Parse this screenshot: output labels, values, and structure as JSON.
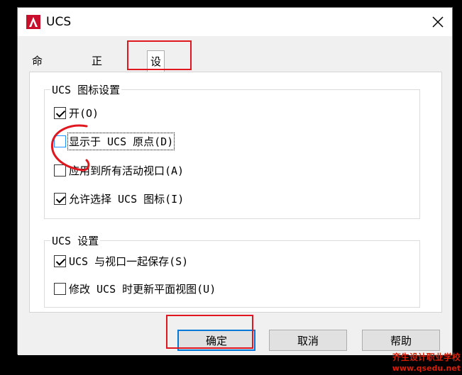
{
  "window": {
    "title": "UCS"
  },
  "tabs": [
    {
      "label": "命名 UCS"
    },
    {
      "label": "正交 UCS"
    },
    {
      "label": "设置"
    }
  ],
  "icon_group": {
    "title": "UCS 图标设置",
    "options": [
      {
        "label": "开(O)",
        "checked": true
      },
      {
        "label": "显示于 UCS 原点(D)",
        "checked": false
      },
      {
        "label": "应用到所有活动视口(A)",
        "checked": false
      },
      {
        "label": "允许选择 UCS 图标(I)",
        "checked": true
      }
    ]
  },
  "ucs_group": {
    "title": "UCS 设置",
    "options": [
      {
        "label": "UCS 与视口一起保存(S)",
        "checked": true
      },
      {
        "label": "修改 UCS 时更新平面视图(U)",
        "checked": false
      }
    ]
  },
  "buttons": {
    "ok": "确定",
    "cancel": "取消",
    "help": "帮助"
  },
  "watermark": {
    "line1": "齐生设计职业学校",
    "line2": "www.qsedu.net"
  },
  "colors": {
    "annotation_red": "#e0171f",
    "accent_blue": "#0078d7"
  }
}
